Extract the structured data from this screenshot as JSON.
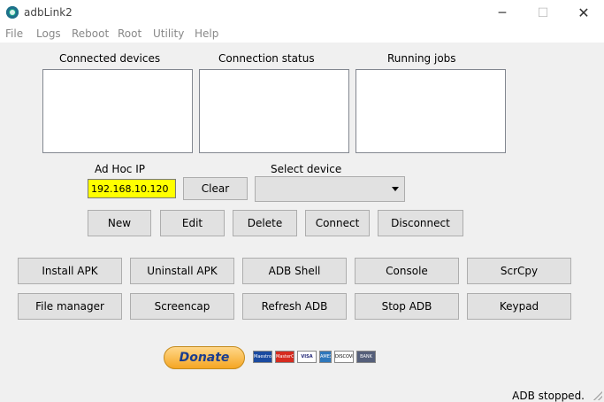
{
  "window": {
    "title": "adbLink2",
    "controls": {
      "minimize": "─",
      "maximize": "☐",
      "close": "✕"
    }
  },
  "menu": [
    "File",
    "Logs",
    "Reboot",
    "Root",
    "Utility",
    "Help"
  ],
  "panels": {
    "connected_devices": "Connected devices",
    "connection_status": "Connection status",
    "running_jobs": "Running jobs"
  },
  "adhoc": {
    "label": "Ad Hoc IP",
    "value": "192.168.10.120",
    "clear_label": "Clear",
    "input_color": "#ffff00"
  },
  "select_device": {
    "label": "Select device",
    "selected": ""
  },
  "device_buttons": {
    "new": "New",
    "edit": "Edit",
    "delete": "Delete",
    "connect": "Connect",
    "disconnect": "Disconnect"
  },
  "tools_row1": {
    "install_apk": "Install APK",
    "uninstall_apk": "Uninstall APK",
    "adb_shell": "ADB Shell",
    "console": "Console",
    "scrcpy": "ScrCpy"
  },
  "tools_row2": {
    "file_manager": "File manager",
    "screencap": "Screencap",
    "refresh_adb": "Refresh ADB",
    "stop_adb": "Stop ADB",
    "keypad": "Keypad"
  },
  "donate": {
    "label": "Donate",
    "cards": [
      "Maestro",
      "MasterCard",
      "VISA",
      "AMEX",
      "DISCOVER",
      "BANK"
    ]
  },
  "status": {
    "text": "ADB stopped."
  }
}
